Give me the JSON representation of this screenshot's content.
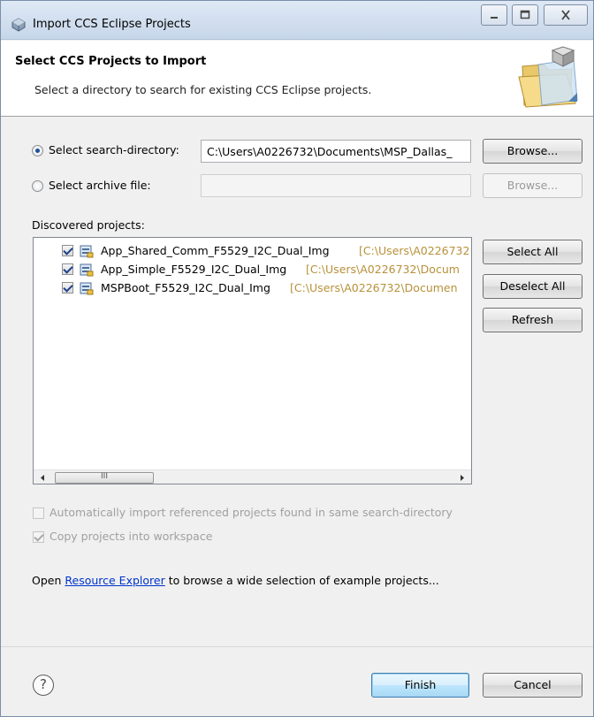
{
  "window": {
    "title": "Import CCS Eclipse Projects"
  },
  "banner": {
    "title": "Select CCS Projects to Import",
    "description": "Select a directory to search for existing CCS Eclipse projects."
  },
  "search_directory": {
    "radio_label": "Select search-directory:",
    "selected": true,
    "value": "C:\\Users\\A0226732\\Documents\\MSP_Dallas_",
    "browse_label": "Browse..."
  },
  "archive_file": {
    "radio_label": "Select archive file:",
    "selected": false,
    "value": "",
    "browse_label": "Browse..."
  },
  "discovered": {
    "label": "Discovered projects:",
    "projects": [
      {
        "name": "App_Shared_Comm_F5529_I2C_Dual_Img",
        "path": "[C:\\Users\\A0226732",
        "checked": true
      },
      {
        "name": "App_Simple_F5529_I2C_Dual_Img",
        "path": "[C:\\Users\\A0226732\\Docum",
        "checked": true
      },
      {
        "name": "MSPBoot_F5529_I2C_Dual_Img",
        "path": "[C:\\Users\\A0226732\\Documen",
        "checked": true
      }
    ],
    "scroll_thumb_grip": "III"
  },
  "side_buttons": {
    "select_all": "Select All",
    "deselect_all": "Deselect All",
    "refresh": "Refresh"
  },
  "options": {
    "auto_import_label": "Automatically import referenced projects found in same search-directory",
    "auto_import_checked": false,
    "copy_label": "Copy projects into workspace",
    "copy_checked": true
  },
  "resource_line": {
    "prefix": "Open ",
    "link": "Resource Explorer",
    "suffix": " to browse a wide selection of example projects..."
  },
  "footer": {
    "help_symbol": "?",
    "finish": "Finish",
    "cancel": "Cancel"
  },
  "colors": {
    "path_text": "#b8913a",
    "link": "#0033cc",
    "titlebar": "#c6d6ea"
  }
}
